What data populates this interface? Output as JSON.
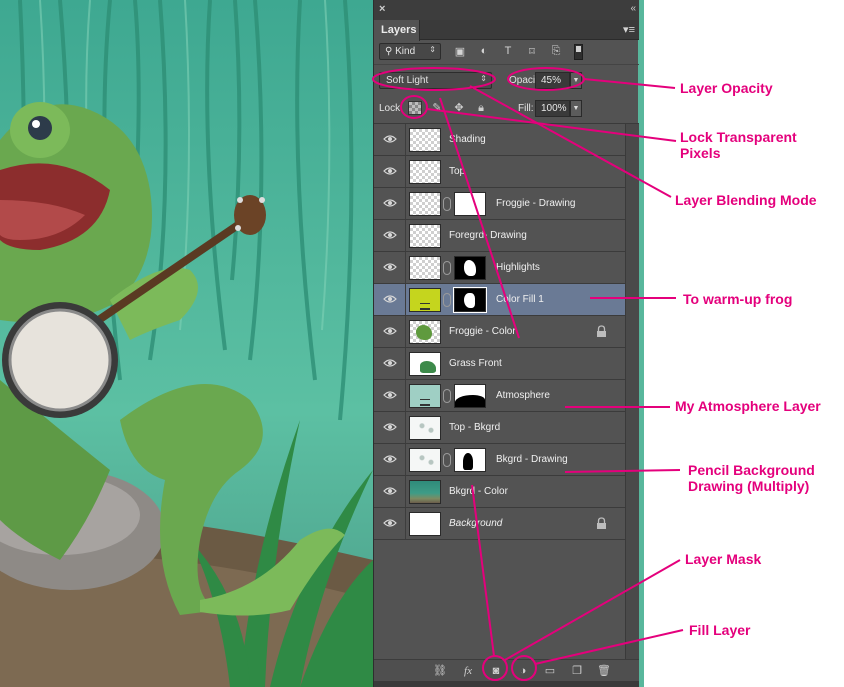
{
  "panel": {
    "close_glyph": "×",
    "collapse_glyph": "«",
    "tab_label": "Layers",
    "menu_glyph": "▾≡",
    "filter": {
      "kind_label": "Kind",
      "icons": [
        "image-filter-icon",
        "adjustment-filter-icon",
        "type-filter-icon",
        "shape-filter-icon",
        "smart-object-filter-icon"
      ],
      "toggle": "filter-toggle"
    },
    "blend_mode": "Soft Light",
    "opacity_label": "Opacity:",
    "opacity_value": "45%",
    "lock_label": "Lock:",
    "fill_label": "Fill:",
    "fill_value": "100%",
    "layers": [
      {
        "name": "Shading",
        "thumb": "checker",
        "mask": null,
        "locked": false,
        "selected": false,
        "italic": false
      },
      {
        "name": "Top",
        "thumb": "checker",
        "mask": null,
        "locked": false,
        "selected": false,
        "italic": false
      },
      {
        "name": "Froggie - Drawing",
        "thumb": "checker",
        "mask": "froggie",
        "locked": false,
        "selected": false,
        "italic": false
      },
      {
        "name": "Foregrd- Drawing",
        "thumb": "checker",
        "mask": null,
        "locked": false,
        "selected": false,
        "italic": false
      },
      {
        "name": "Highlights",
        "thumb": "checker",
        "mask": "highlights",
        "locked": false,
        "selected": false,
        "italic": false
      },
      {
        "name": "Color Fill 1",
        "thumb": "lime",
        "mask": "color",
        "locked": false,
        "selected": true,
        "italic": false
      },
      {
        "name": "Froggie - Color",
        "thumb": "frog",
        "mask": null,
        "locked": true,
        "selected": false,
        "italic": false
      },
      {
        "name": "Grass Front",
        "thumb": "grass",
        "mask": null,
        "locked": false,
        "selected": false,
        "italic": false
      },
      {
        "name": "Atmosphere",
        "thumb": "atmo",
        "mask": "atmo",
        "locked": false,
        "selected": false,
        "italic": false
      },
      {
        "name": "Top - Bkgrd",
        "thumb": "sketch",
        "mask": null,
        "locked": false,
        "selected": false,
        "italic": false
      },
      {
        "name": "Bkgrd - Drawing",
        "thumb": "sketch",
        "mask": "bkdraw",
        "locked": false,
        "selected": false,
        "italic": false
      },
      {
        "name": "Bkgrd - Color",
        "thumb": "bkgrd",
        "mask": null,
        "locked": false,
        "selected": false,
        "italic": false
      },
      {
        "name": "Background",
        "thumb": "white",
        "mask": null,
        "locked": true,
        "selected": false,
        "italic": true
      }
    ],
    "bottom_icons": [
      "link-layers-icon",
      "fx-icon",
      "add-mask-icon",
      "new-fill-layer-icon",
      "new-group-icon",
      "new-layer-icon",
      "delete-layer-icon"
    ],
    "fx_label": "fx"
  },
  "annotations": {
    "layer_opacity": "Layer Opacity",
    "lock_transparent": "Lock Transparent\nPixels",
    "blending_mode": "Layer Blending Mode",
    "warm_up": "To warm-up frog",
    "atmosphere": "My Atmosphere Layer",
    "pencil_bg": "Pencil Background\nDrawing (Multiply)",
    "layer_mask": "Layer Mask",
    "fill_layer": "Fill Layer"
  },
  "colors": {
    "annotation": "#e4007c",
    "selected_row": "#6a7a95",
    "panel_bg": "#535353",
    "fill_thumb": "#c5d51e"
  }
}
